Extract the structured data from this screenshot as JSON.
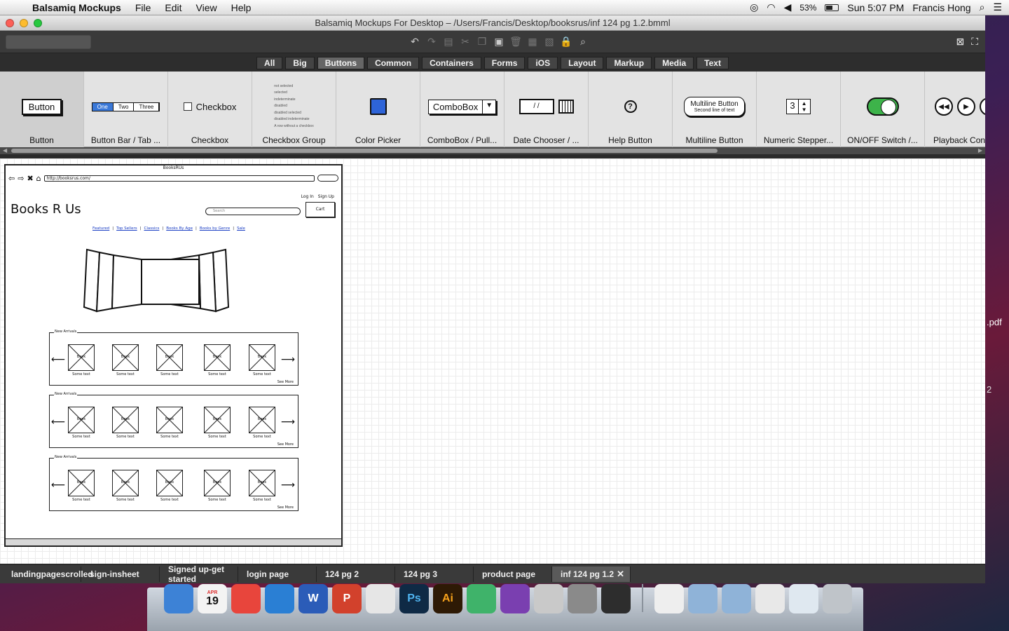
{
  "menubar": {
    "app_name": "Balsamiq Mockups",
    "menus": [
      "File",
      "Edit",
      "View",
      "Help"
    ],
    "battery": "53%",
    "clock": "Sun 5:07 PM",
    "user": "Francis Hong"
  },
  "window": {
    "title": "Balsamiq Mockups For Desktop – /Users/Francis/Desktop/booksrus/inf 124 pg 1.2.bmml"
  },
  "filter_tabs": [
    "All",
    "Big",
    "Buttons",
    "Common",
    "Containers",
    "Forms",
    "iOS",
    "Layout",
    "Markup",
    "Media",
    "Text"
  ],
  "filter_active": "Buttons",
  "library": {
    "items": [
      "Button",
      "Button Bar / Tab ...",
      "Checkbox",
      "Checkbox Group",
      "Color Picker",
      "ComboBox / Pull...",
      "Date Chooser / ...",
      "Help Button",
      "Multiline Button",
      "Numeric Stepper...",
      "ON/OFF Switch /...",
      "Playback Cont"
    ],
    "button_preview": "Button",
    "buttonbar_preview": [
      "One",
      "Two",
      "Three"
    ],
    "checkbox_preview": "Checkbox",
    "checkbox_group_preview": [
      "not selected",
      "selected",
      "indeterminate",
      "disabled",
      "disabled selected",
      "disabled indeterminate",
      "A row without a checkbox"
    ],
    "combobox_preview": "ComboBox",
    "date_preview": "/ /",
    "help_preview": "?",
    "multiline_preview": "Multiline Button",
    "multiline_sub": "Second line of text",
    "stepper_preview": "3"
  },
  "mockup": {
    "window_title": "BooksRUs",
    "url": "http://booksrus.com/",
    "login": "Log In",
    "signup": "Sign Up",
    "logo": "Books R Us",
    "search_placeholder": "Search",
    "cart": "Cart",
    "nav_links": [
      "Featured",
      "Top Sellers",
      "Classics",
      "Books By Age",
      "Books by Genre",
      "Sale"
    ],
    "sections": [
      {
        "label": "New Arrivals",
        "book": "Book",
        "caption": "Some text",
        "more": "See More"
      },
      {
        "label": "New Arrivals",
        "book": "Book",
        "caption": "Some text",
        "more": "See More"
      },
      {
        "label": "New Arrivals",
        "book": "Book",
        "caption": "Some text",
        "more": "See More"
      }
    ]
  },
  "bottom_tabs": [
    "landingpagescrolled",
    "sign-insheet",
    "Signed up-get started",
    "login page",
    "124 pg 2",
    "124 pg 3",
    "product page",
    "inf 124 pg 1.2"
  ],
  "bottom_tab_active": "inf 124 pg 1.2",
  "desktop": {
    "file_label": ".pdf",
    "file_label_2": "2"
  },
  "dock": {
    "apps": [
      "Finder",
      "Calendar",
      "Chrome",
      "iTunes",
      "Word",
      "PowerPoint",
      "TextEdit",
      "Photoshop",
      "Illustrator",
      "Atom",
      "GitHub",
      "Balsamiq",
      "System Preferences",
      "Activity Monitor",
      "XML File",
      "Documents",
      "Downloads",
      "Preview",
      "Screen",
      "Trash"
    ],
    "calendar_date": "19",
    "calendar_month": "APR"
  },
  "colors": {
    "accent": "#3a78d8",
    "switch_on": "#3db34a",
    "canvas_grid": "#ececec"
  }
}
